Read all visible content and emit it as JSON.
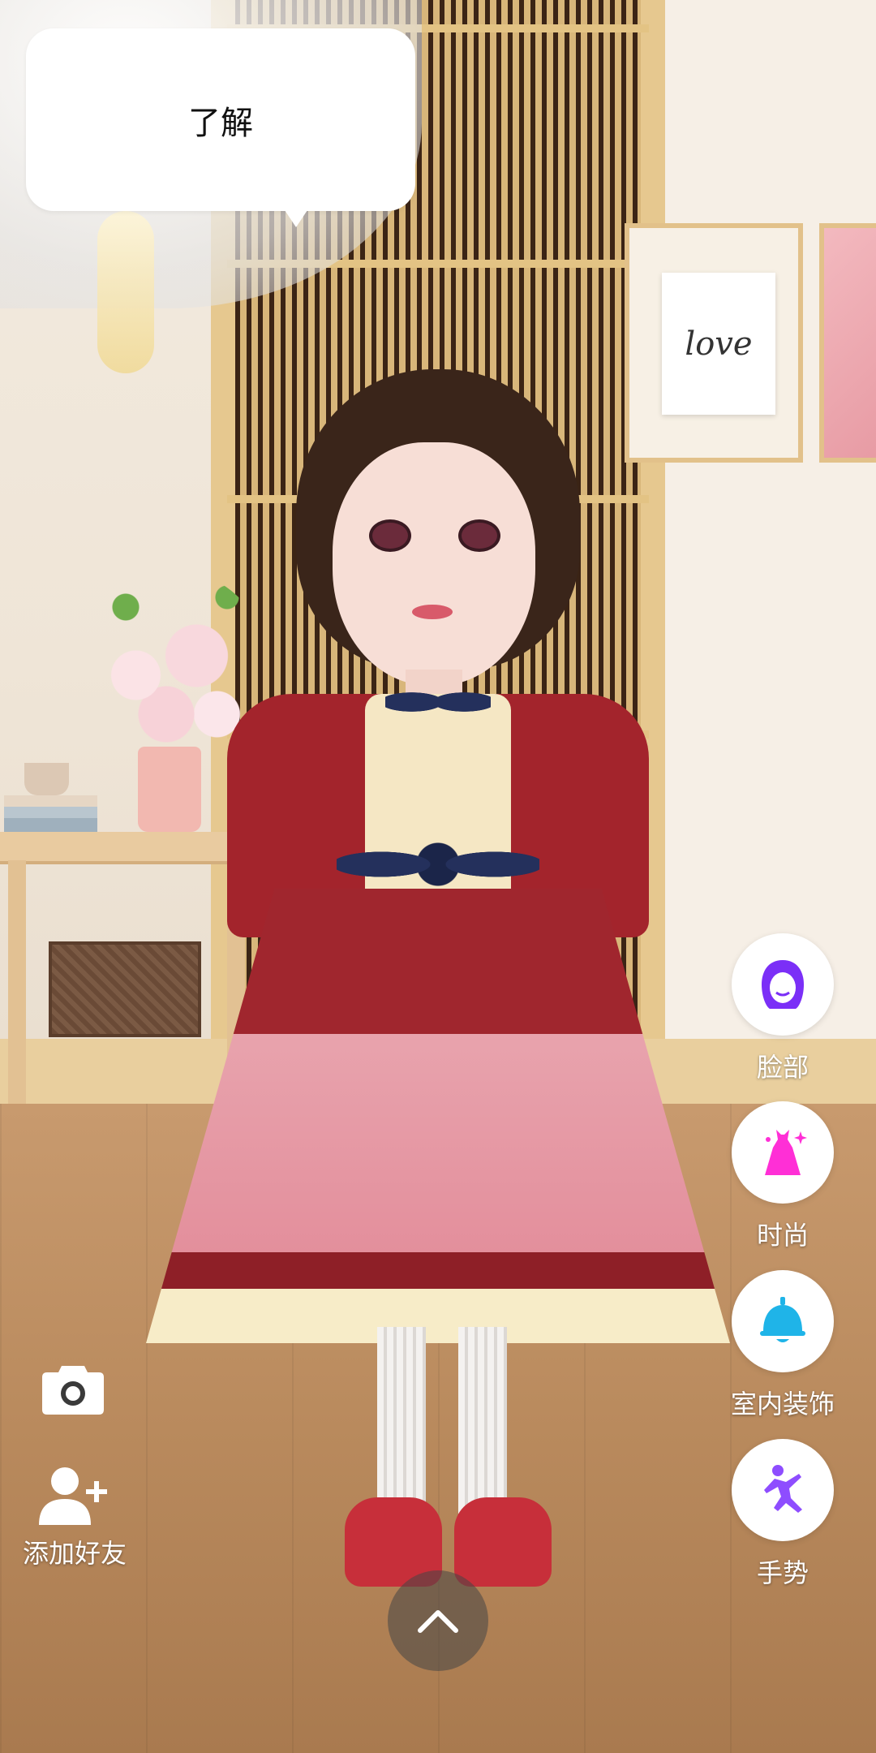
{
  "dialog": {
    "message": "了解"
  },
  "background": {
    "wall_art_text": "love"
  },
  "side_menu": {
    "items": [
      {
        "label": "脸部",
        "icon": "face-icon",
        "color": "#7b2ff7"
      },
      {
        "label": "时尚",
        "icon": "dress-icon",
        "color": "#ff2fd6"
      },
      {
        "label": "室内装饰",
        "icon": "bell-lamp-icon",
        "color": "#1fb4e8"
      },
      {
        "label": "手势",
        "icon": "pose-icon",
        "color": "#8e4dff"
      }
    ]
  },
  "left_tools": {
    "camera": {
      "icon": "camera-icon"
    },
    "add_friend": {
      "label": "添加好友",
      "icon": "add-friend-icon"
    }
  },
  "bottom": {
    "expand_icon": "chevron-up-icon"
  }
}
